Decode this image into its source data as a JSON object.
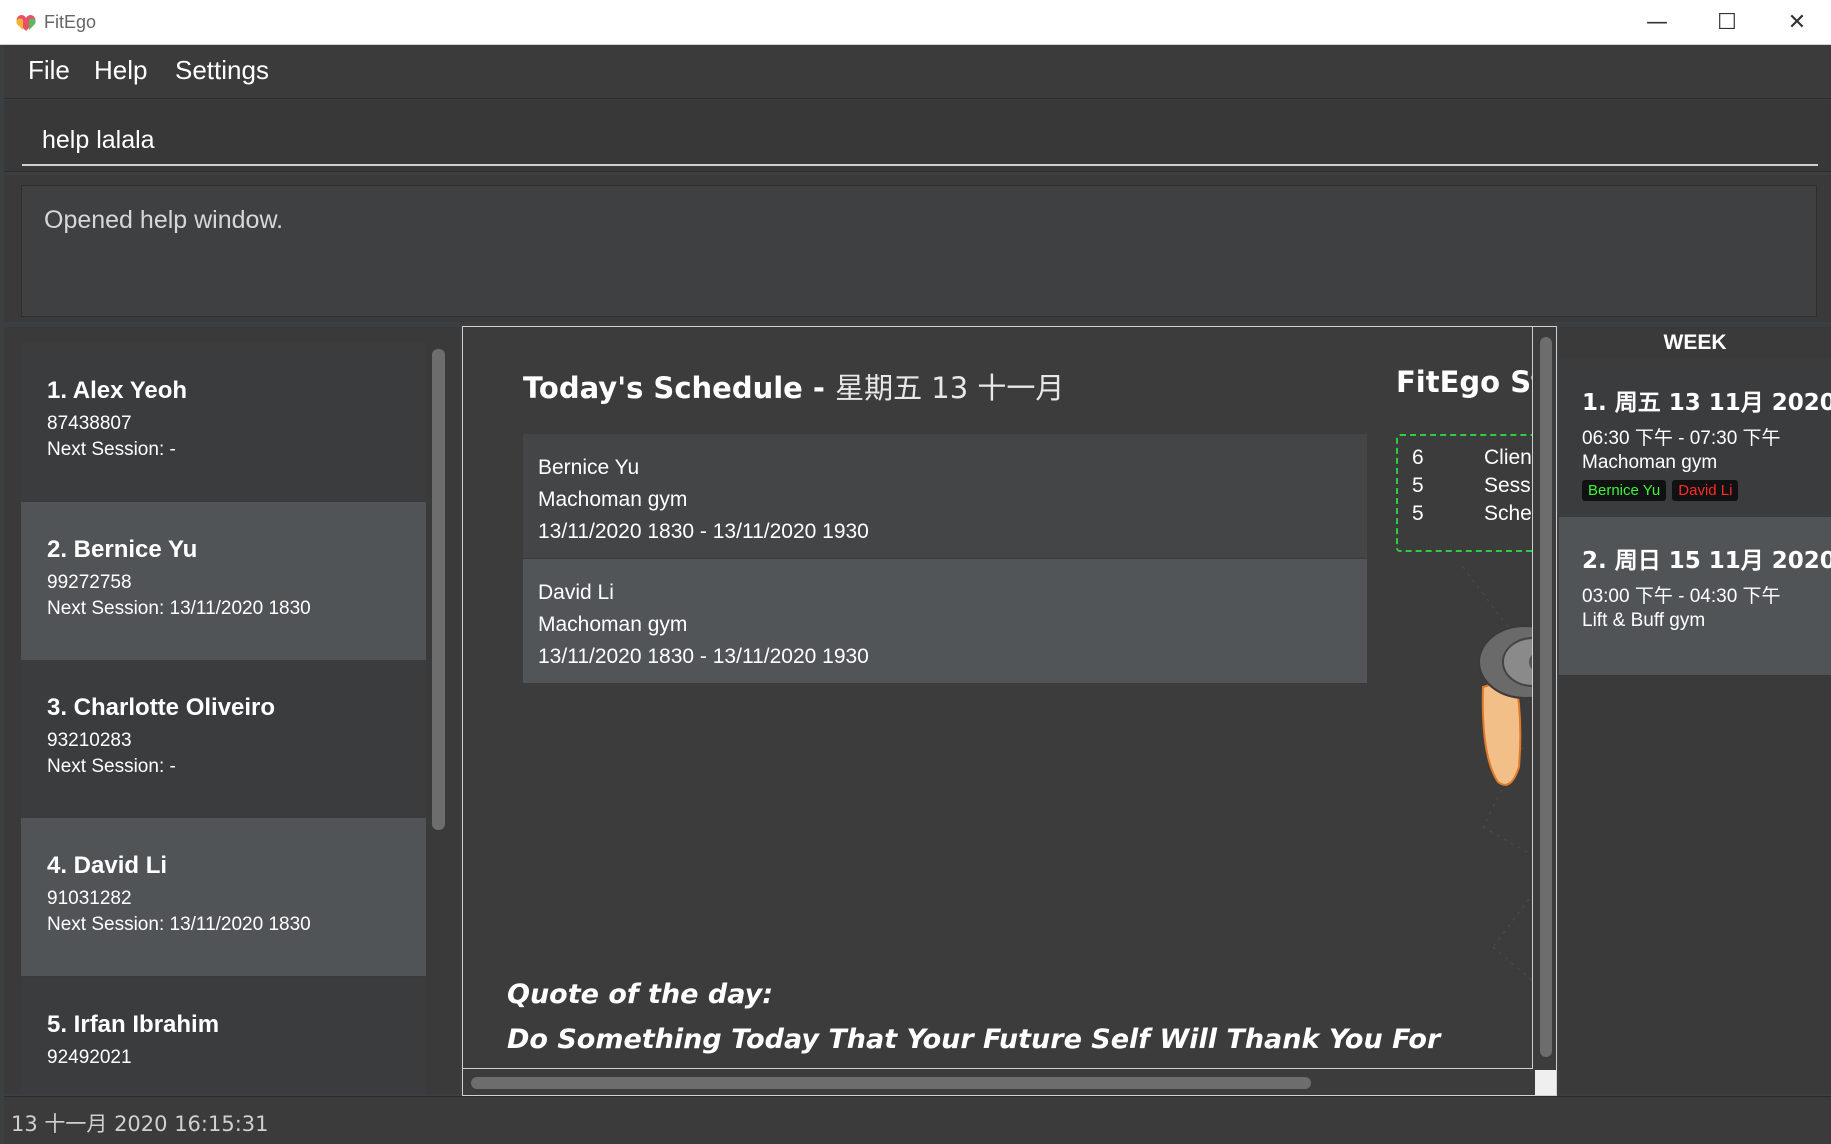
{
  "window": {
    "title": "FitEgo",
    "minimize": "—",
    "maximize": "☐",
    "close": "✕"
  },
  "menu": {
    "items": [
      "File",
      "Help",
      "Settings"
    ]
  },
  "command": {
    "value": "help lalala"
  },
  "result": {
    "message": "Opened help window."
  },
  "clients": [
    {
      "name": "1.  Alex Yeoh",
      "phone": "87438807",
      "next_session": "Next Session:  -"
    },
    {
      "name": "2.  Bernice Yu",
      "phone": "99272758",
      "next_session": "Next Session: 13/11/2020 1830"
    },
    {
      "name": "3.  Charlotte Oliveiro",
      "phone": "93210283",
      "next_session": "Next Session:  -"
    },
    {
      "name": "4.  David Li",
      "phone": "91031282",
      "next_session": "Next Session: 13/11/2020 1830"
    },
    {
      "name": "5.  Irfan Ibrahim",
      "phone": "92492021",
      "next_session": ""
    }
  ],
  "schedule": {
    "title": "Today's Schedule - ",
    "date": "星期五 13 十一月",
    "sessions": [
      {
        "client": "Bernice Yu",
        "gym": "Machoman gym",
        "time": "13/11/2020 1830 - 13/11/2020 1930"
      },
      {
        "client": "David Li",
        "gym": "Machoman gym",
        "time": "13/11/2020 1830 - 13/11/2020 1930"
      }
    ]
  },
  "stats": {
    "title": "FitEgo Sta",
    "rows": [
      {
        "count": "6",
        "label": "Clien"
      },
      {
        "count": "5",
        "label": "Sessi"
      },
      {
        "count": "5",
        "label": "Sche"
      }
    ]
  },
  "quote": {
    "label": "Quote of the day:",
    "text": "Do Something Today That Your Future Self Will Thank You For"
  },
  "week": {
    "header": "WEEK",
    "days": [
      {
        "date": "1.  周五 13 11月 2020",
        "time": "06:30 下午 - 07:30 下午",
        "gym": "Machoman gym",
        "tags": [
          "Bernice Yu",
          "David Li"
        ]
      },
      {
        "date": "2.  周日 15 11月 2020",
        "time": "03:00 下午 - 04:30 下午",
        "gym": "Lift & Buff gym",
        "tags": []
      }
    ]
  },
  "status": {
    "datetime": "13 十一月 2020 16:15:31"
  },
  "colors": {
    "background": "#3c3f41",
    "card_dark": "#3b3c3e",
    "card_light": "#505457",
    "tag_green": "#3df53d",
    "tag_red": "#ff2a2a",
    "stats_border": "#2ecc40"
  },
  "icons": [
    "app-logo-icon",
    "dumbbell-icon"
  ]
}
